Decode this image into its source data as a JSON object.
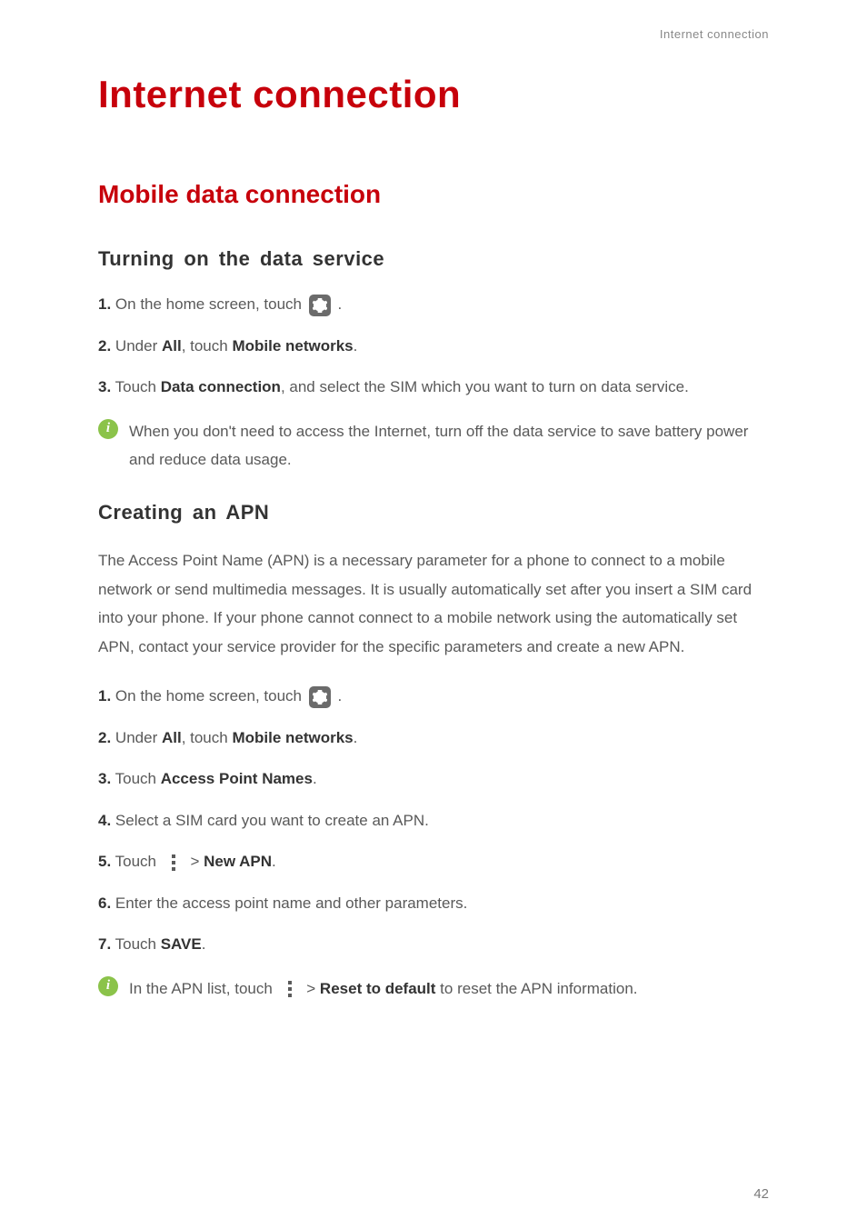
{
  "header": {
    "label": "Internet connection"
  },
  "chapter": {
    "title": "Internet connection"
  },
  "section": {
    "title": "Mobile data connection"
  },
  "sub1": {
    "title": "Turning on the data service",
    "step1_num": "1.",
    "step1_text_a": "On the home screen, touch ",
    "step1_text_b": ".",
    "step2_num": "2.",
    "step2_text_a": "Under ",
    "step2_all": "All",
    "step2_text_b": ", touch ",
    "step2_mn": "Mobile networks",
    "step2_text_c": ".",
    "step3_num": "3.",
    "step3_text_a": "Touch ",
    "step3_dc": "Data connection",
    "step3_text_b": ", and select the SIM which you want to turn on data service.",
    "note_text": "When you don't need to access the Internet, turn off the data service to save battery power and reduce data usage."
  },
  "sub2": {
    "title": "Creating an APN",
    "para": "The Access Point Name (APN) is a necessary parameter for a phone to connect to a mobile network or send multimedia messages. It is usually automatically set after you insert a SIM card into your phone. If your phone cannot connect to a mobile network using the automatically set APN, contact your service provider for the specific parameters and create a new APN.",
    "step1_num": "1.",
    "step1_text_a": "On the home screen, touch ",
    "step1_text_b": ".",
    "step2_num": "2.",
    "step2_text_a": "Under ",
    "step2_all": "All",
    "step2_text_b": ", touch ",
    "step2_mn": "Mobile networks",
    "step2_text_c": ".",
    "step3_num": "3.",
    "step3_text_a": "Touch ",
    "step3_apn": "Access Point Names",
    "step3_text_b": ".",
    "step4_num": "4.",
    "step4_text": "Select a SIM card you want to create an APN.",
    "step5_num": "5.",
    "step5_text_a": "Touch ",
    "step5_gt": " > ",
    "step5_new": "New APN",
    "step5_text_b": ".",
    "step6_num": "6.",
    "step6_text": "Enter the access point name and other parameters.",
    "step7_num": "7.",
    "step7_text_a": "Touch ",
    "step7_save": "SAVE",
    "step7_text_b": ".",
    "note_text_a": "In the APN list, touch ",
    "note_gt": " > ",
    "note_reset": "Reset to default",
    "note_text_b": " to reset the APN information."
  },
  "page_number": "42"
}
